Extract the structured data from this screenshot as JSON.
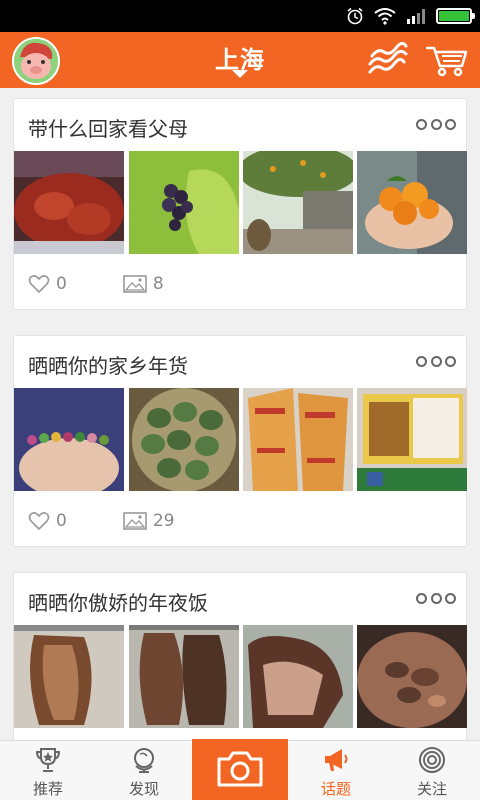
{
  "header": {
    "city": "上海",
    "accent_color": "#f26522"
  },
  "status_bar": {
    "icons": [
      "alarm-icon",
      "wifi-icon",
      "signal-icon",
      "battery-icon"
    ],
    "battery_level": 1.0
  },
  "cards": [
    {
      "title": "带什么回家看父母",
      "likes": "0",
      "photos_count": "8",
      "photos": [
        "food-tray",
        "grapes",
        "orange-tree",
        "tangerines-in-hand"
      ]
    },
    {
      "title": "晒晒你的家乡年货",
      "likes": "0",
      "photos_count": "29",
      "photos": [
        "bead-bracelet",
        "green-rice-cakes",
        "bagged-snacks",
        "packaged-goods"
      ]
    },
    {
      "title": "晒晒你傲娇的年夜饭",
      "photos": [
        "cured-meat-1",
        "cured-meat-2",
        "cured-meat-3",
        "braised-dish"
      ]
    }
  ],
  "nav": {
    "recommend": "推荐",
    "discover": "发现",
    "topics": "话题",
    "follow": "关注"
  }
}
